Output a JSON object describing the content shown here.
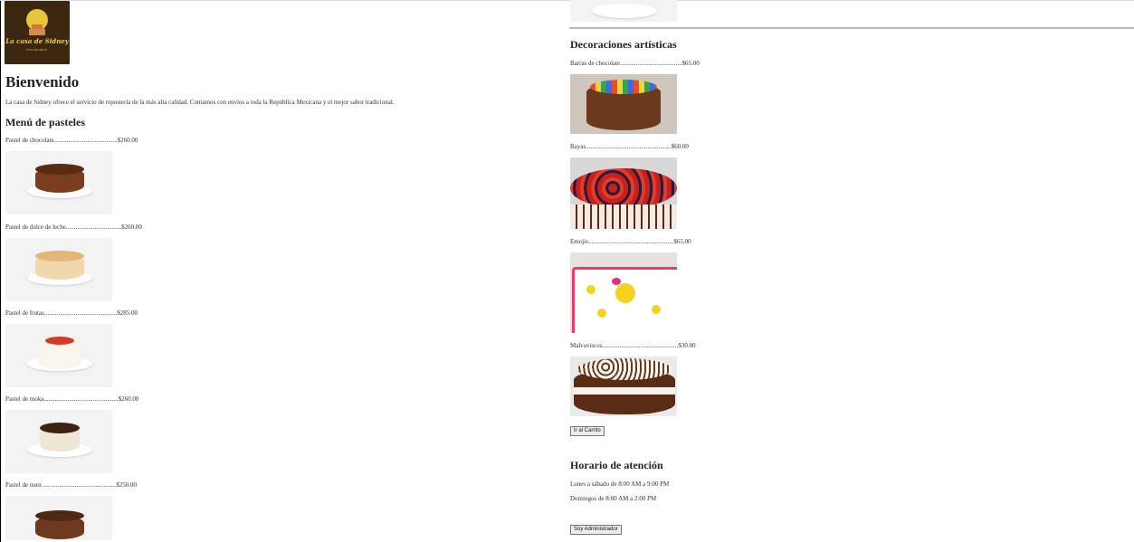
{
  "header": {
    "logo_text": "La casa de Sidney",
    "logo_subtext": "PASTELERÍA",
    "title": "Bienvenido",
    "intro": "La casa de Sidney ofrece el servicio de repostería de la más alta calidad. Contamos con envíos a toda la República Mexicana y el mejor sabor tradicional."
  },
  "menu": {
    "title": "Menú de pasteles",
    "items": [
      {
        "label": "Pastel de chocolate........................................$260.00",
        "image": "chocolate-cake"
      },
      {
        "label": "Pastel de dulce de leche...................................$260.00",
        "image": "dulce-de-leche-cake"
      },
      {
        "label": "Pastel de frutas..............................................$285.00",
        "image": "fruit-cake"
      },
      {
        "label": "Pastel de moka...............................................$260.00",
        "image": "moka-cake"
      },
      {
        "label": "Pastel de nuez...............................................$250.00",
        "image": "walnut-cake"
      }
    ]
  },
  "decorations": {
    "title": "Decoraciones artísticas",
    "items": [
      {
        "label": "Barras de chocolate.......................................$65.00",
        "image": "chocolate-bars-cake"
      },
      {
        "label": "Bayas......................................................$60.00",
        "image": "berries-cake"
      },
      {
        "label": "Emojis......................................................$65.00",
        "image": "emoji-cake"
      },
      {
        "label": "Malvaviscos................................................$30.00",
        "image": "marshmallow-cake"
      }
    ],
    "cart_button": "Ir al Carrito"
  },
  "hours": {
    "title": "Horario de atención",
    "weekdays": "Lunes a sábado de 8:00 AM a 9:00 PM",
    "sundays": "Domingos de 8:00 AM a 2:00 PM",
    "admin_button": "Soy Administrador"
  },
  "colors": {
    "logo_bg": "#3b2610",
    "logo_accent": "#e7c43a",
    "photo_bg": "#f3f3f3",
    "divider": "#b9b9b9"
  }
}
